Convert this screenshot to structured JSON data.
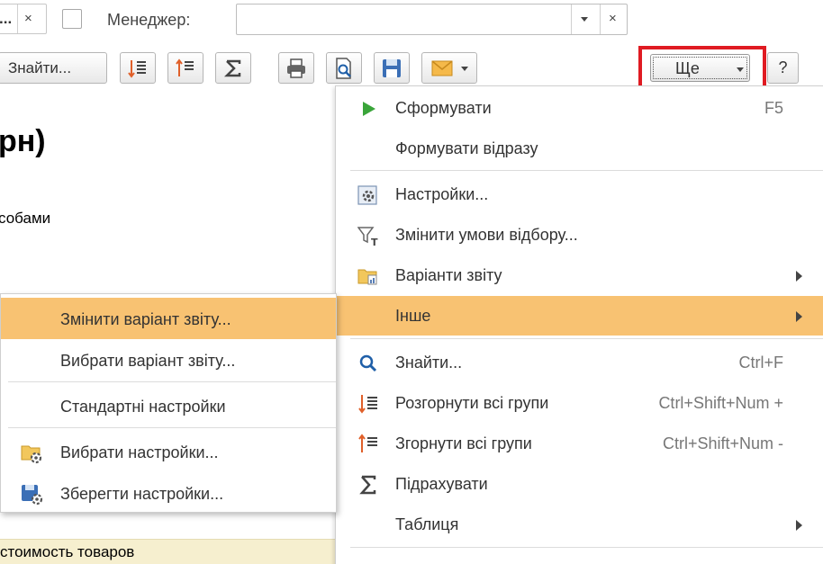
{
  "filter": {
    "prev_field_text": "...",
    "clear_symbol": "×",
    "manager_label": "Менеджер:",
    "manager_value": ""
  },
  "toolbar": {
    "find_label": "Знайти...",
    "more_label": "Ще",
    "help_label": "?"
  },
  "report": {
    "title_fragment": "рн)",
    "subtitle_fragment": "собами",
    "row_fragment": "стоимость товаров"
  },
  "menu": {
    "items": [
      {
        "label": "Сформувати",
        "shortcut": "F5",
        "icon": "play-icon"
      },
      {
        "label": "Формувати відразу",
        "shortcut": "",
        "icon": ""
      },
      {
        "label": "Настройки...",
        "shortcut": "",
        "icon": "settings-icon"
      },
      {
        "label": "Змінити умови відбору...",
        "shortcut": "",
        "icon": "filter-icon"
      },
      {
        "label": "Варіанти звіту",
        "shortcut": "",
        "icon": "folder-report-icon",
        "submenu": true
      },
      {
        "label": "Інше",
        "shortcut": "",
        "icon": "",
        "submenu": true,
        "active": true
      },
      {
        "label": "Знайти...",
        "shortcut": "Ctrl+F",
        "icon": "search-icon"
      },
      {
        "label": "Розгорнути всі групи",
        "shortcut": "Ctrl+Shift+Num +",
        "icon": "expand-groups-icon"
      },
      {
        "label": "Згорнути всі групи",
        "shortcut": "Ctrl+Shift+Num -",
        "icon": "collapse-groups-icon"
      },
      {
        "label": "Підрахувати",
        "shortcut": "",
        "icon": "sigma-icon"
      },
      {
        "label": "Таблиця",
        "shortcut": "",
        "icon": "",
        "submenu": true
      }
    ]
  },
  "submenu": {
    "items": [
      {
        "label": "Змінити варіант звіту...",
        "active": true
      },
      {
        "label": "Вибрати варіант звіту..."
      },
      {
        "label": "Стандартні настройки"
      },
      {
        "label": "Вибрати настройки...",
        "icon": "folder-settings-icon"
      },
      {
        "label": "Зберегти настройки...",
        "icon": "save-settings-icon"
      }
    ]
  },
  "colors": {
    "highlight_border": "#e01b22",
    "active_item": "#f8c272",
    "report_row_bg": "#f6efcf"
  }
}
